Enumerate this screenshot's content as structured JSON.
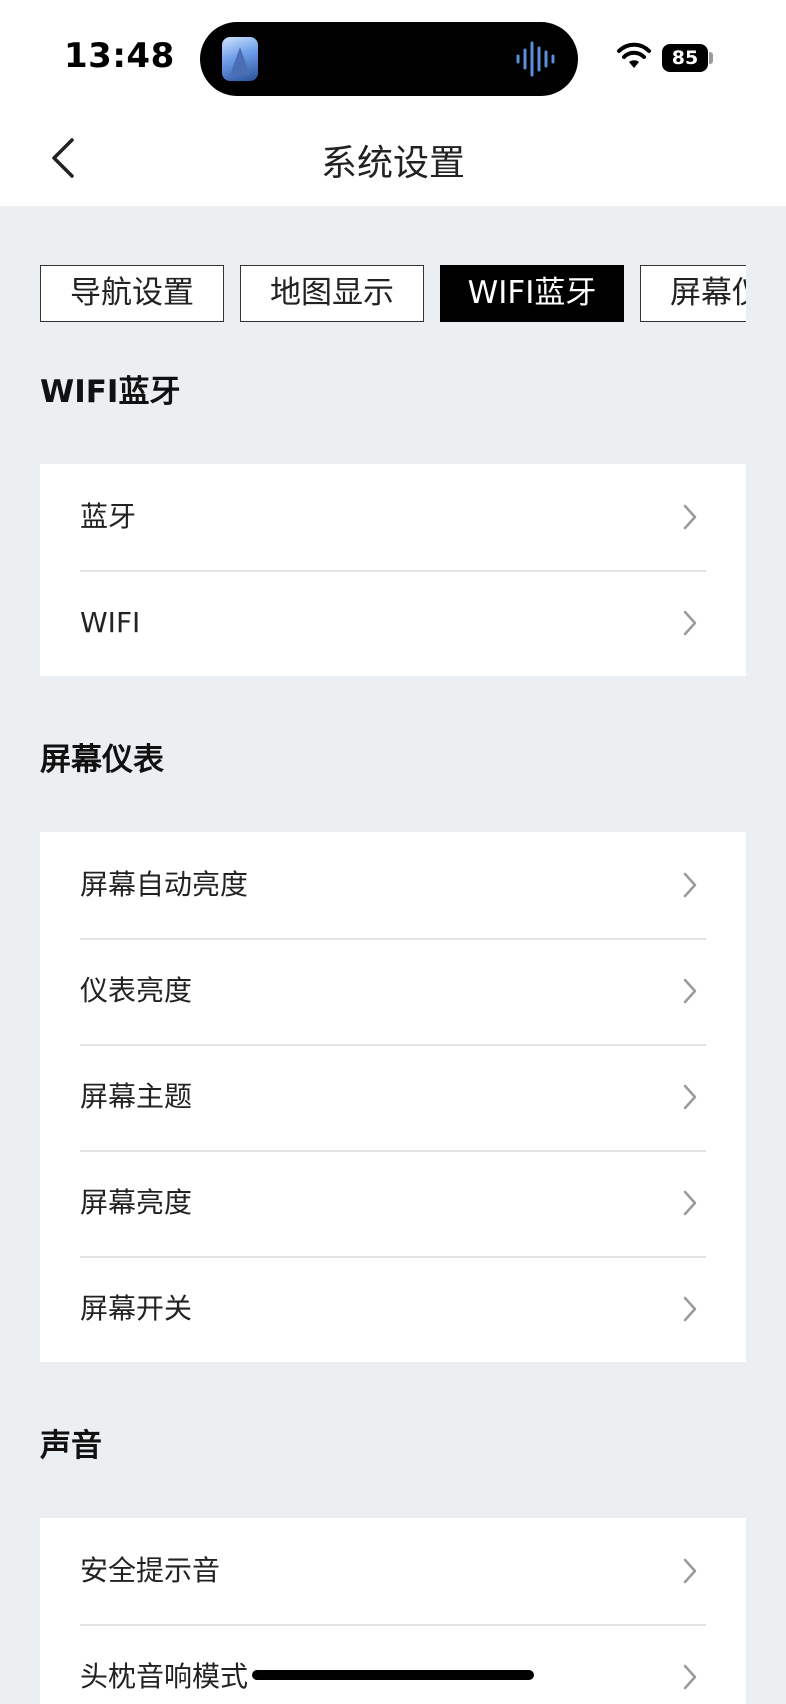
{
  "status_bar": {
    "time": "13:48",
    "battery": "85",
    "icons": [
      "app-thumbnail-icon",
      "voice-wave-icon",
      "wifi-icon",
      "battery-icon"
    ]
  },
  "nav": {
    "title": "系统设置",
    "back_icon": "chevron-left-icon"
  },
  "tabs": [
    {
      "label": "导航设置",
      "active": false
    },
    {
      "label": "地图显示",
      "active": false
    },
    {
      "label": "WIFI蓝牙",
      "active": true
    },
    {
      "label": "屏幕仪表",
      "active": false
    }
  ],
  "sections": [
    {
      "title": "WIFI蓝牙",
      "items": [
        {
          "label": "蓝牙"
        },
        {
          "label": "WIFI"
        }
      ]
    },
    {
      "title": "屏幕仪表",
      "items": [
        {
          "label": "屏幕自动亮度"
        },
        {
          "label": "仪表亮度"
        },
        {
          "label": "屏幕主题"
        },
        {
          "label": "屏幕亮度"
        },
        {
          "label": "屏幕开关"
        }
      ]
    },
    {
      "title": "声音",
      "items": [
        {
          "label": "安全提示音"
        },
        {
          "label": "头枕音响模式"
        }
      ]
    }
  ],
  "colors": {
    "background": "#eceff2",
    "card": "#ffffff",
    "active_tab": "#000000",
    "chevron": "#9a9a9a"
  }
}
